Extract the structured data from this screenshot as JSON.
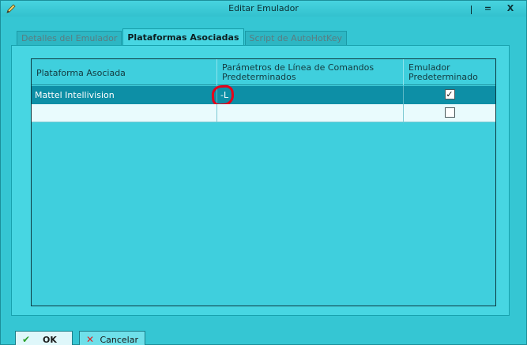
{
  "window": {
    "title": "Editar Emulador",
    "controls": [
      "|",
      "=",
      "X"
    ]
  },
  "tabs": [
    {
      "label": "Detalles del Emulador",
      "active": false
    },
    {
      "label": "Plataformas Asociadas",
      "active": true
    },
    {
      "label": "Script de AutoHotKey",
      "active": false
    }
  ],
  "grid": {
    "columns": [
      "Plataforma Asociada",
      "Parámetros de Línea de Comandos Predeterminados",
      "Emulador Predeterminado"
    ],
    "rows": [
      {
        "platform": "Mattel Intellivision",
        "params": "-L",
        "default": true,
        "selected": true
      },
      {
        "platform": "",
        "params": "",
        "default": false,
        "selected": false
      }
    ]
  },
  "buttons": {
    "ok": "OK",
    "cancel": "Cancelar"
  },
  "colors": {
    "window_bg": "#35c6d3",
    "selected_row": "#0d8fa6",
    "annotation": "#e6001a",
    "ok_icon": "#2aa02a",
    "cancel_icon": "#dd2222"
  }
}
